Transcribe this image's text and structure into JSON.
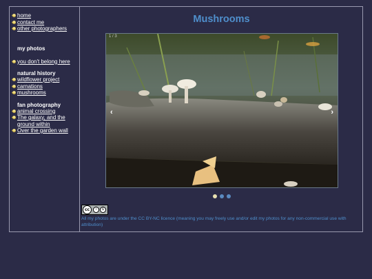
{
  "sidebar": {
    "links_top": [
      {
        "label": "home"
      },
      {
        "label": "contact me"
      },
      {
        "label": "other photographers"
      }
    ],
    "my_photos": {
      "title": "my photos",
      "items": [
        {
          "label": "you don't belong here"
        }
      ]
    },
    "natural_history": {
      "title": "natural history",
      "items": [
        {
          "label": "wildflower project"
        },
        {
          "label": "carnations"
        },
        {
          "label": "mushrooms"
        }
      ]
    },
    "fan_photography": {
      "title": "fan photography",
      "items": [
        {
          "label": "animal crossing"
        },
        {
          "label": "The galaxy, and the ground within"
        },
        {
          "label": "Over the garden wall"
        }
      ]
    }
  },
  "main": {
    "title": "Mushrooms",
    "slideshow": {
      "counter": "1 / 3",
      "prev_icon": "‹",
      "next_icon": "›",
      "current_index": 0,
      "total": 3
    },
    "license": {
      "badge": "cc",
      "text": "All my photos are under the CC BY-NC licence (meaning you may freely use and/or edit my photos for any non-commercial use with attribution)"
    }
  },
  "colors": {
    "background": "#2b2b47",
    "accent": "#4f8fcc",
    "border": "#9a9ab0"
  }
}
